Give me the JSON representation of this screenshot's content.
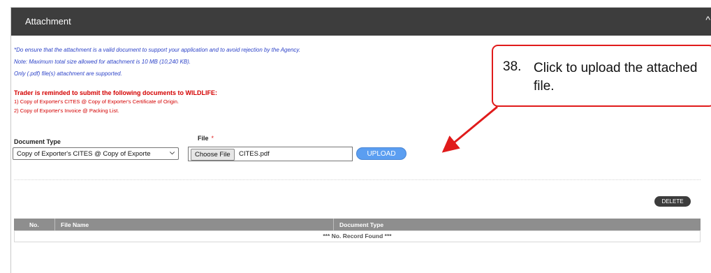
{
  "panel": {
    "title": "Attachment",
    "collapse_glyph": "^"
  },
  "notes": [
    "*Do ensure that the attachment is a valid document to support your application and to avoid rejection by the Agency.",
    "Note: Maximum total size allowed for attachment is 10 MB (10,240 KB).",
    "Only (.pdf) file(s) attachment are supported."
  ],
  "reminder": {
    "title": "Trader is reminded to submit the following documents to WILDLIFE:",
    "items": [
      "1) Copy of Exporter's CITES @ Copy of Exporter's Certificate of Origin.",
      "2) Copy of Exporter's Invoice @ Packing List."
    ]
  },
  "form": {
    "document_type_label": "Document Type",
    "document_type_value": "Copy of Exporter's CITES @ Copy of Exporte",
    "file_label": "File",
    "required_mark": "*",
    "choose_file_label": "Choose File",
    "file_name": "CITES.pdf",
    "upload_label": "UPLOAD"
  },
  "table": {
    "delete_label": "DELETE",
    "columns": [
      "No.",
      "File Name",
      "Document Type"
    ],
    "empty_text": "*** No. Record Found ***"
  },
  "callout": {
    "number": "38.",
    "text": "Click to upload the attached file."
  },
  "colors": {
    "header_bg": "#3d3d3d",
    "note_blue": "#2d43c8",
    "reminder_red": "#d40000",
    "upload_blue": "#5b9ef1",
    "callout_red": "#e01b1b"
  },
  "icons": {
    "collapse": "chevron-up-icon",
    "select": "chevron-down-icon"
  }
}
